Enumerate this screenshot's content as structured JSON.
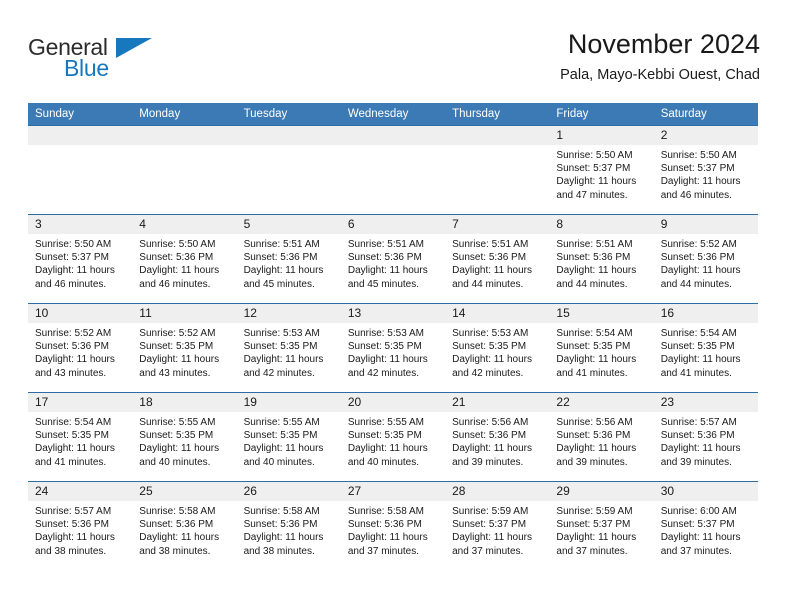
{
  "brand": {
    "name_part1": "General",
    "name_part2": "Blue",
    "triangle_color": "#1878be"
  },
  "header": {
    "title": "November 2024",
    "subtitle": "Pala, Mayo-Kebbi Ouest, Chad"
  },
  "theme": {
    "header_bg": "#3c7ab5",
    "header_text": "#ffffff",
    "daynum_bg": "#efefef",
    "cell_border": "#2e6da4",
    "text": "#1a1a1a"
  },
  "weekdays": [
    "Sunday",
    "Monday",
    "Tuesday",
    "Wednesday",
    "Thursday",
    "Friday",
    "Saturday"
  ],
  "weeks": [
    [
      {
        "day": ""
      },
      {
        "day": ""
      },
      {
        "day": ""
      },
      {
        "day": ""
      },
      {
        "day": ""
      },
      {
        "day": "1",
        "sunrise": "Sunrise: 5:50 AM",
        "sunset": "Sunset: 5:37 PM",
        "daylight": "Daylight: 11 hours and 47 minutes."
      },
      {
        "day": "2",
        "sunrise": "Sunrise: 5:50 AM",
        "sunset": "Sunset: 5:37 PM",
        "daylight": "Daylight: 11 hours and 46 minutes."
      }
    ],
    [
      {
        "day": "3",
        "sunrise": "Sunrise: 5:50 AM",
        "sunset": "Sunset: 5:37 PM",
        "daylight": "Daylight: 11 hours and 46 minutes."
      },
      {
        "day": "4",
        "sunrise": "Sunrise: 5:50 AM",
        "sunset": "Sunset: 5:36 PM",
        "daylight": "Daylight: 11 hours and 46 minutes."
      },
      {
        "day": "5",
        "sunrise": "Sunrise: 5:51 AM",
        "sunset": "Sunset: 5:36 PM",
        "daylight": "Daylight: 11 hours and 45 minutes."
      },
      {
        "day": "6",
        "sunrise": "Sunrise: 5:51 AM",
        "sunset": "Sunset: 5:36 PM",
        "daylight": "Daylight: 11 hours and 45 minutes."
      },
      {
        "day": "7",
        "sunrise": "Sunrise: 5:51 AM",
        "sunset": "Sunset: 5:36 PM",
        "daylight": "Daylight: 11 hours and 44 minutes."
      },
      {
        "day": "8",
        "sunrise": "Sunrise: 5:51 AM",
        "sunset": "Sunset: 5:36 PM",
        "daylight": "Daylight: 11 hours and 44 minutes."
      },
      {
        "day": "9",
        "sunrise": "Sunrise: 5:52 AM",
        "sunset": "Sunset: 5:36 PM",
        "daylight": "Daylight: 11 hours and 44 minutes."
      }
    ],
    [
      {
        "day": "10",
        "sunrise": "Sunrise: 5:52 AM",
        "sunset": "Sunset: 5:36 PM",
        "daylight": "Daylight: 11 hours and 43 minutes."
      },
      {
        "day": "11",
        "sunrise": "Sunrise: 5:52 AM",
        "sunset": "Sunset: 5:35 PM",
        "daylight": "Daylight: 11 hours and 43 minutes."
      },
      {
        "day": "12",
        "sunrise": "Sunrise: 5:53 AM",
        "sunset": "Sunset: 5:35 PM",
        "daylight": "Daylight: 11 hours and 42 minutes."
      },
      {
        "day": "13",
        "sunrise": "Sunrise: 5:53 AM",
        "sunset": "Sunset: 5:35 PM",
        "daylight": "Daylight: 11 hours and 42 minutes."
      },
      {
        "day": "14",
        "sunrise": "Sunrise: 5:53 AM",
        "sunset": "Sunset: 5:35 PM",
        "daylight": "Daylight: 11 hours and 42 minutes."
      },
      {
        "day": "15",
        "sunrise": "Sunrise: 5:54 AM",
        "sunset": "Sunset: 5:35 PM",
        "daylight": "Daylight: 11 hours and 41 minutes."
      },
      {
        "day": "16",
        "sunrise": "Sunrise: 5:54 AM",
        "sunset": "Sunset: 5:35 PM",
        "daylight": "Daylight: 11 hours and 41 minutes."
      }
    ],
    [
      {
        "day": "17",
        "sunrise": "Sunrise: 5:54 AM",
        "sunset": "Sunset: 5:35 PM",
        "daylight": "Daylight: 11 hours and 41 minutes."
      },
      {
        "day": "18",
        "sunrise": "Sunrise: 5:55 AM",
        "sunset": "Sunset: 5:35 PM",
        "daylight": "Daylight: 11 hours and 40 minutes."
      },
      {
        "day": "19",
        "sunrise": "Sunrise: 5:55 AM",
        "sunset": "Sunset: 5:35 PM",
        "daylight": "Daylight: 11 hours and 40 minutes."
      },
      {
        "day": "20",
        "sunrise": "Sunrise: 5:55 AM",
        "sunset": "Sunset: 5:35 PM",
        "daylight": "Daylight: 11 hours and 40 minutes."
      },
      {
        "day": "21",
        "sunrise": "Sunrise: 5:56 AM",
        "sunset": "Sunset: 5:36 PM",
        "daylight": "Daylight: 11 hours and 39 minutes."
      },
      {
        "day": "22",
        "sunrise": "Sunrise: 5:56 AM",
        "sunset": "Sunset: 5:36 PM",
        "daylight": "Daylight: 11 hours and 39 minutes."
      },
      {
        "day": "23",
        "sunrise": "Sunrise: 5:57 AM",
        "sunset": "Sunset: 5:36 PM",
        "daylight": "Daylight: 11 hours and 39 minutes."
      }
    ],
    [
      {
        "day": "24",
        "sunrise": "Sunrise: 5:57 AM",
        "sunset": "Sunset: 5:36 PM",
        "daylight": "Daylight: 11 hours and 38 minutes."
      },
      {
        "day": "25",
        "sunrise": "Sunrise: 5:58 AM",
        "sunset": "Sunset: 5:36 PM",
        "daylight": "Daylight: 11 hours and 38 minutes."
      },
      {
        "day": "26",
        "sunrise": "Sunrise: 5:58 AM",
        "sunset": "Sunset: 5:36 PM",
        "daylight": "Daylight: 11 hours and 38 minutes."
      },
      {
        "day": "27",
        "sunrise": "Sunrise: 5:58 AM",
        "sunset": "Sunset: 5:36 PM",
        "daylight": "Daylight: 11 hours and 37 minutes."
      },
      {
        "day": "28",
        "sunrise": "Sunrise: 5:59 AM",
        "sunset": "Sunset: 5:37 PM",
        "daylight": "Daylight: 11 hours and 37 minutes."
      },
      {
        "day": "29",
        "sunrise": "Sunrise: 5:59 AM",
        "sunset": "Sunset: 5:37 PM",
        "daylight": "Daylight: 11 hours and 37 minutes."
      },
      {
        "day": "30",
        "sunrise": "Sunrise: 6:00 AM",
        "sunset": "Sunset: 5:37 PM",
        "daylight": "Daylight: 11 hours and 37 minutes."
      }
    ]
  ]
}
